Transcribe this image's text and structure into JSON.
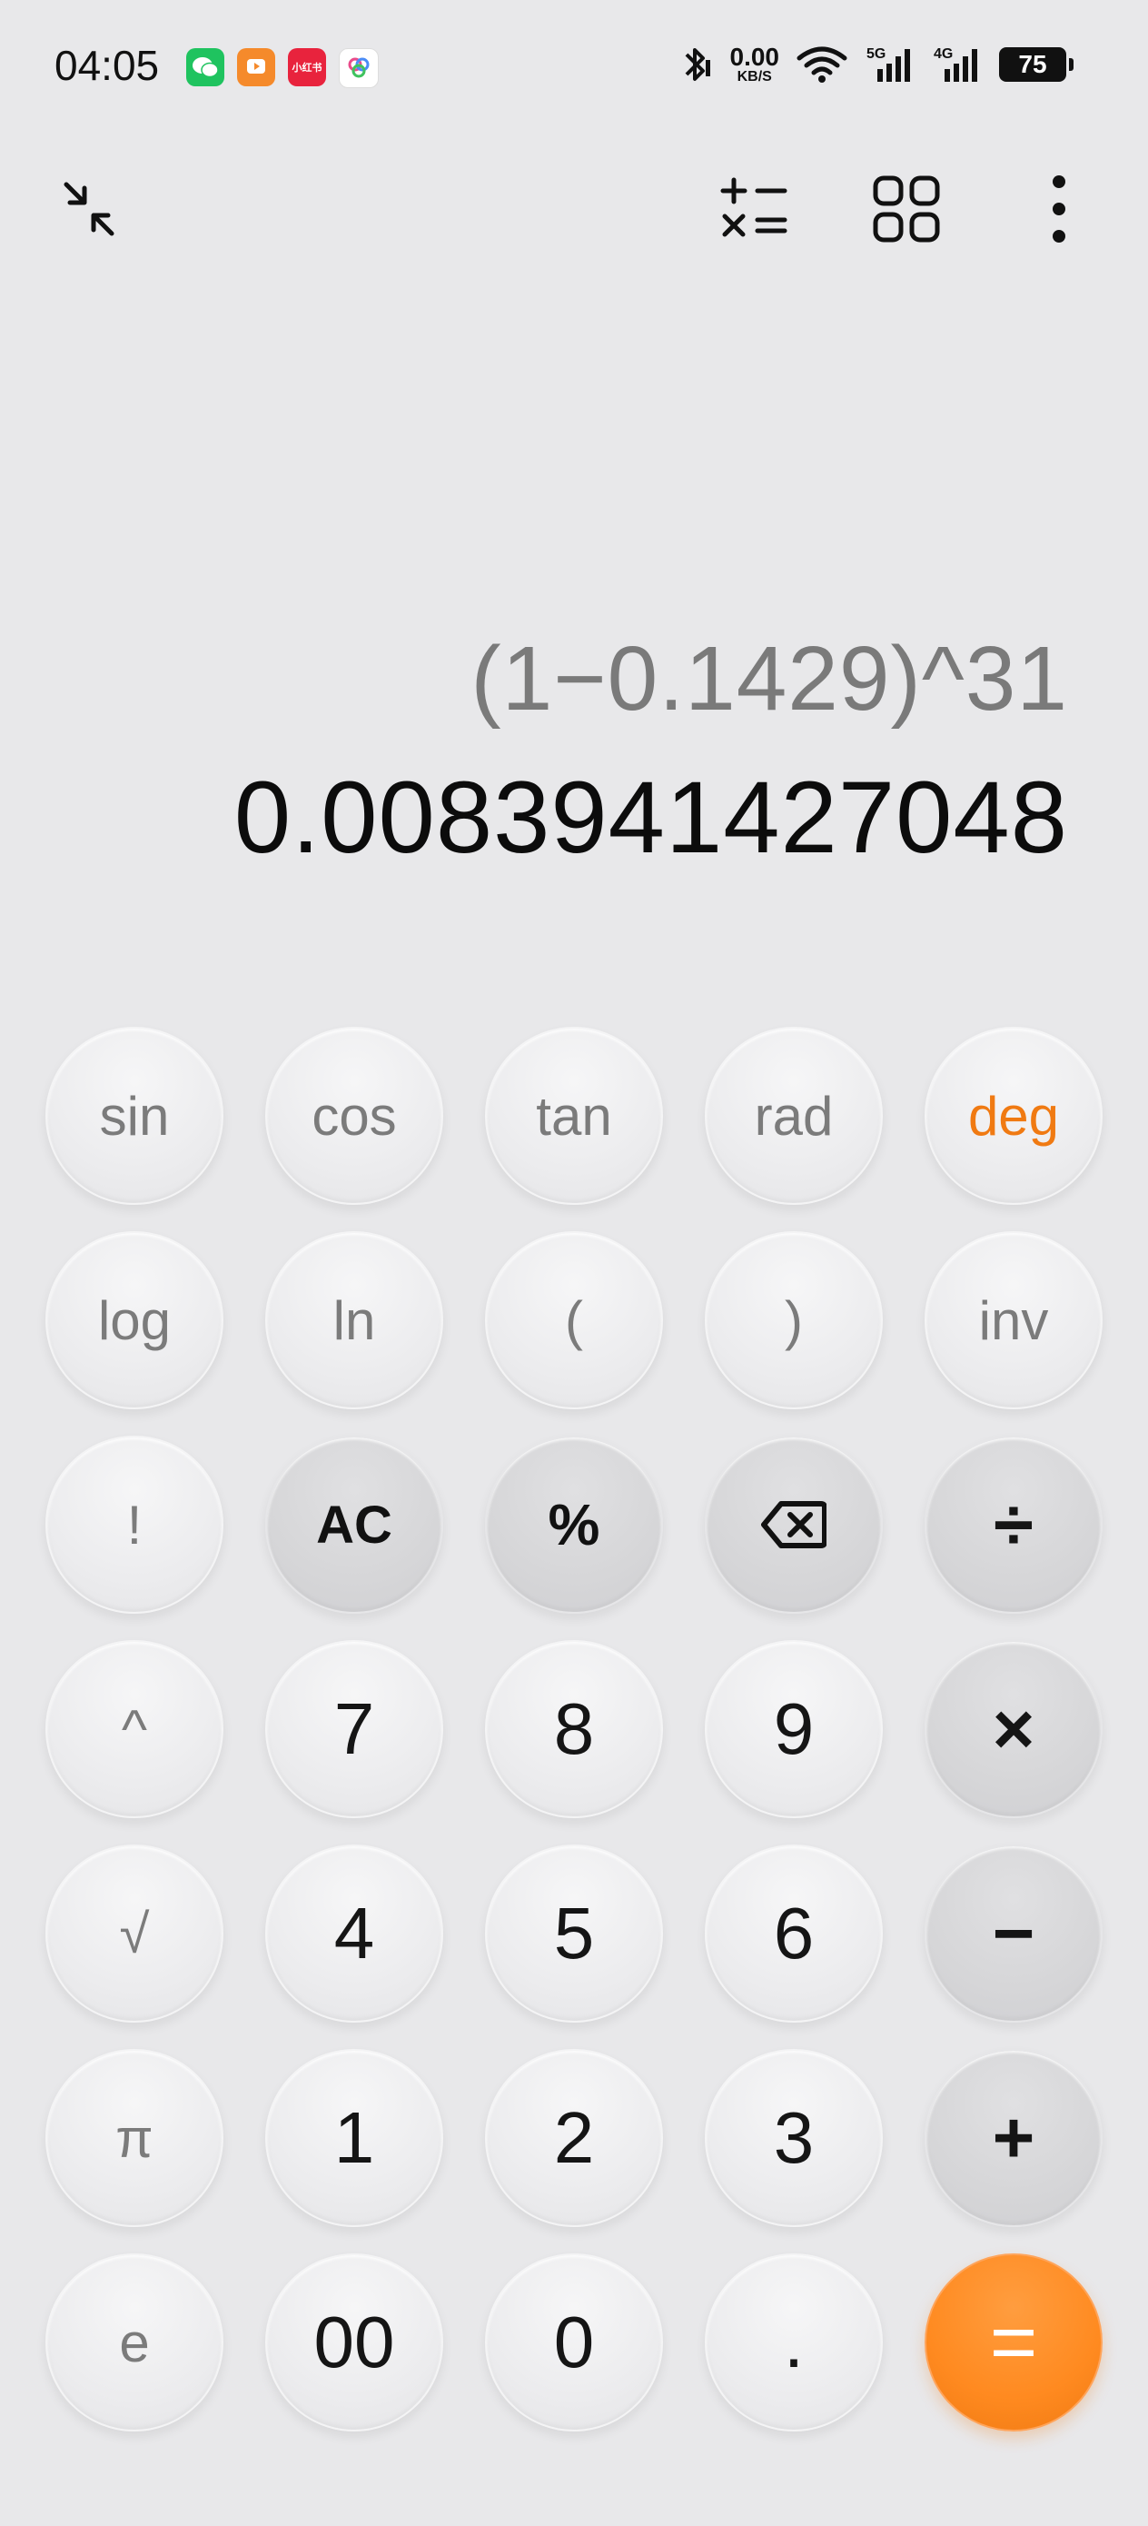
{
  "status_bar": {
    "time": "04:05",
    "net_speed_value": "0.00",
    "net_speed_unit": "KB/S",
    "battery": "75",
    "signal1_label": "5G",
    "signal2_label": "4G",
    "app_icons": [
      "wechat-icon",
      "video-app-icon",
      "xiaohongshu-icon",
      "photos-icon"
    ],
    "xiaohongshu_label": "小红书"
  },
  "toolbar": {
    "collapse_icon": "collapse-icon",
    "converter_icon": "unit-converter-icon",
    "grid_icon": "grid-icon",
    "more_icon": "more-vertical-icon"
  },
  "display": {
    "expression": "(1−0.1429)^31",
    "result": "0.0083941427048"
  },
  "keypad": {
    "rows": [
      [
        "sin",
        "cos",
        "tan",
        "rad",
        "deg"
      ],
      [
        "log",
        "ln",
        "(",
        ")",
        "inv"
      ],
      [
        "!",
        "AC",
        "%",
        "⌫",
        "÷"
      ],
      [
        "^",
        "7",
        "8",
        "9",
        "×"
      ],
      [
        "√",
        "4",
        "5",
        "6",
        "−"
      ],
      [
        "π",
        "1",
        "2",
        "3",
        "+"
      ],
      [
        "e",
        "00",
        "0",
        ".",
        "="
      ]
    ]
  },
  "colors": {
    "background": "#e8e8ea",
    "accent": "#f07a12",
    "expression_text": "#7a7a7a",
    "result_text": "#0c0c0c"
  }
}
